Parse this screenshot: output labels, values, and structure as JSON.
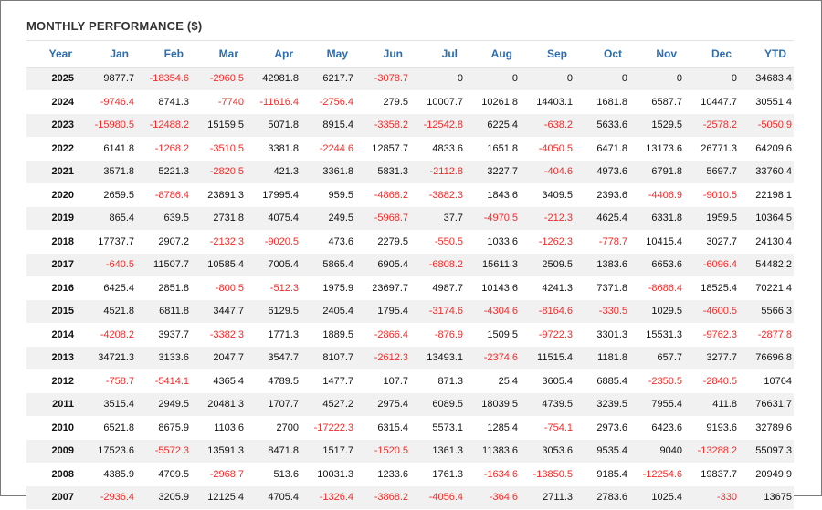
{
  "title": "MONTHLY PERFORMANCE ($)",
  "colors": {
    "header_text": "#2f6dab",
    "negative": "#e8302e",
    "stripe": "#f1f1f1"
  },
  "headers": [
    "Year",
    "Jan",
    "Feb",
    "Mar",
    "Apr",
    "May",
    "Jun",
    "Jul",
    "Aug",
    "Sep",
    "Oct",
    "Nov",
    "Dec",
    "YTD"
  ],
  "rows": [
    [
      "2025",
      "9877.7",
      "-18354.6",
      "-2960.5",
      "42981.8",
      "6217.7",
      "-3078.7",
      "0",
      "0",
      "0",
      "0",
      "0",
      "0",
      "34683.4"
    ],
    [
      "2024",
      "-9746.4",
      "8741.3",
      "-7740",
      "-11616.4",
      "-2756.4",
      "279.5",
      "10007.7",
      "10261.8",
      "14403.1",
      "1681.8",
      "6587.7",
      "10447.7",
      "30551.4"
    ],
    [
      "2023",
      "-15980.5",
      "-12488.2",
      "15159.5",
      "5071.8",
      "8915.4",
      "-3358.2",
      "-12542.8",
      "6225.4",
      "-638.2",
      "5633.6",
      "1529.5",
      "-2578.2",
      "-5050.9"
    ],
    [
      "2022",
      "6141.8",
      "-1268.2",
      "-3510.5",
      "3381.8",
      "-2244.6",
      "12857.7",
      "4833.6",
      "1651.8",
      "-4050.5",
      "6471.8",
      "13173.6",
      "26771.3",
      "64209.6"
    ],
    [
      "2021",
      "3571.8",
      "5221.3",
      "-2820.5",
      "421.3",
      "3361.8",
      "5831.3",
      "-2112.8",
      "3227.7",
      "-404.6",
      "4973.6",
      "6791.8",
      "5697.7",
      "33760.4"
    ],
    [
      "2020",
      "2659.5",
      "-8786.4",
      "23891.3",
      "17995.4",
      "959.5",
      "-4868.2",
      "-3882.3",
      "1843.6",
      "3409.5",
      "2393.6",
      "-4406.9",
      "-9010.5",
      "22198.1"
    ],
    [
      "2019",
      "865.4",
      "639.5",
      "2731.8",
      "4075.4",
      "249.5",
      "-5968.7",
      "37.7",
      "-4970.5",
      "-212.3",
      "4625.4",
      "6331.8",
      "1959.5",
      "10364.5"
    ],
    [
      "2018",
      "17737.7",
      "2907.2",
      "-2132.3",
      "-9020.5",
      "473.6",
      "2279.5",
      "-550.5",
      "1033.6",
      "-1262.3",
      "-778.7",
      "10415.4",
      "3027.7",
      "24130.4"
    ],
    [
      "2017",
      "-640.5",
      "11507.7",
      "10585.4",
      "7005.4",
      "5865.4",
      "6905.4",
      "-6808.2",
      "15611.3",
      "2509.5",
      "1383.6",
      "6653.6",
      "-6096.4",
      "54482.2"
    ],
    [
      "2016",
      "6425.4",
      "2851.8",
      "-800.5",
      "-512.3",
      "1975.9",
      "23697.7",
      "4987.7",
      "10143.6",
      "4241.3",
      "7371.8",
      "-8686.4",
      "18525.4",
      "70221.4"
    ],
    [
      "2015",
      "4521.8",
      "6811.8",
      "3447.7",
      "6129.5",
      "2405.4",
      "1795.4",
      "-3174.6",
      "-4304.6",
      "-8164.6",
      "-330.5",
      "1029.5",
      "-4600.5",
      "5566.3"
    ],
    [
      "2014",
      "-4208.2",
      "3937.7",
      "-3382.3",
      "1771.3",
      "1889.5",
      "-2866.4",
      "-876.9",
      "1509.5",
      "-9722.3",
      "3301.3",
      "15531.3",
      "-9762.3",
      "-2877.8"
    ],
    [
      "2013",
      "34721.3",
      "3133.6",
      "2047.7",
      "3547.7",
      "8107.7",
      "-2612.3",
      "13493.1",
      "-2374.6",
      "11515.4",
      "1181.8",
      "657.7",
      "3277.7",
      "76696.8"
    ],
    [
      "2012",
      "-758.7",
      "-5414.1",
      "4365.4",
      "4789.5",
      "1477.7",
      "107.7",
      "871.3",
      "25.4",
      "3605.4",
      "6885.4",
      "-2350.5",
      "-2840.5",
      "10764"
    ],
    [
      "2011",
      "3515.4",
      "2949.5",
      "20481.3",
      "1707.7",
      "4527.2",
      "2975.4",
      "6089.5",
      "18039.5",
      "4739.5",
      "3239.5",
      "7955.4",
      "411.8",
      "76631.7"
    ],
    [
      "2010",
      "6521.8",
      "8675.9",
      "1103.6",
      "2700",
      "-17222.3",
      "6315.4",
      "5573.1",
      "1285.4",
      "-754.1",
      "2973.6",
      "6423.6",
      "9193.6",
      "32789.6"
    ],
    [
      "2009",
      "17523.6",
      "-5572.3",
      "13591.3",
      "8471.8",
      "1517.7",
      "-1520.5",
      "1361.3",
      "11383.6",
      "3053.6",
      "9535.4",
      "9040",
      "-13288.2",
      "55097.3"
    ],
    [
      "2008",
      "4385.9",
      "4709.5",
      "-2968.7",
      "513.6",
      "10031.3",
      "1233.6",
      "1761.3",
      "-1634.6",
      "-13850.5",
      "9185.4",
      "-12254.6",
      "19837.7",
      "20949.9"
    ],
    [
      "2007",
      "-2936.4",
      "3205.9",
      "12125.4",
      "4705.4",
      "-1326.4",
      "-3868.2",
      "-4056.4",
      "-364.6",
      "2711.3",
      "2783.6",
      "1025.4",
      "-330",
      "13675"
    ]
  ]
}
